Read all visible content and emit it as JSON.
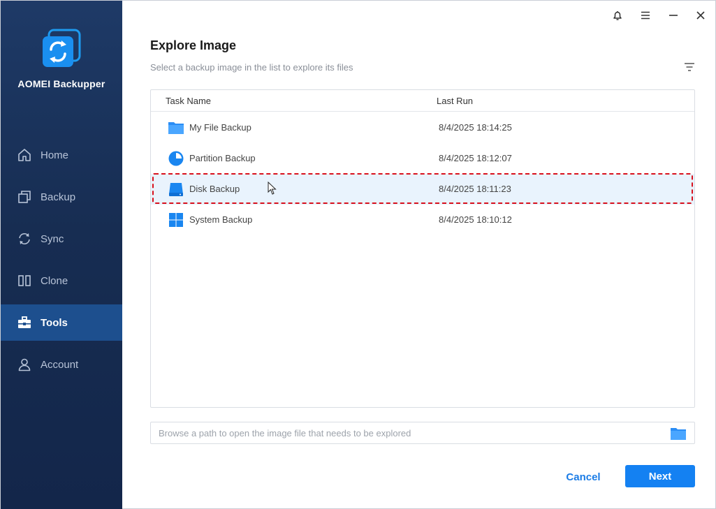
{
  "app": {
    "name": "AOMEI Backupper"
  },
  "sidebar": {
    "items": [
      {
        "label": "Home",
        "icon": "home-icon"
      },
      {
        "label": "Backup",
        "icon": "backup-icon"
      },
      {
        "label": "Sync",
        "icon": "sync-icon"
      },
      {
        "label": "Clone",
        "icon": "clone-icon"
      },
      {
        "label": "Tools",
        "icon": "tools-icon",
        "active": true
      },
      {
        "label": "Account",
        "icon": "account-icon"
      }
    ]
  },
  "window_controls": [
    "bell-icon",
    "menu-icon",
    "minimize-icon",
    "close-icon"
  ],
  "dialog": {
    "title": "Explore Image",
    "subtitle": "Select a backup image in the list to explore its files"
  },
  "table": {
    "columns": [
      "Task Name",
      "Last Run"
    ],
    "rows": [
      {
        "name": "My File Backup",
        "last_run": "8/4/2025 18:14:25",
        "icon": "folder-icon"
      },
      {
        "name": "Partition Backup",
        "last_run": "8/4/2025 18:12:07",
        "icon": "partition-icon"
      },
      {
        "name": "Disk Backup",
        "last_run": "8/4/2025 18:11:23",
        "icon": "disk-icon",
        "selected": true
      },
      {
        "name": "System Backup",
        "last_run": "8/4/2025 18:10:12",
        "icon": "windows-icon"
      }
    ]
  },
  "path_input": {
    "value": "",
    "placeholder": "Browse a path to open the image file that needs to be explored"
  },
  "buttons": {
    "cancel": "Cancel",
    "next": "Next"
  },
  "colors": {
    "accent": "#1481f2",
    "sidebar_bg": "#172d52",
    "sidebar_active": "#1d4f8e",
    "selection_outline": "#d9101c",
    "selected_row": "#e9f3fd"
  }
}
